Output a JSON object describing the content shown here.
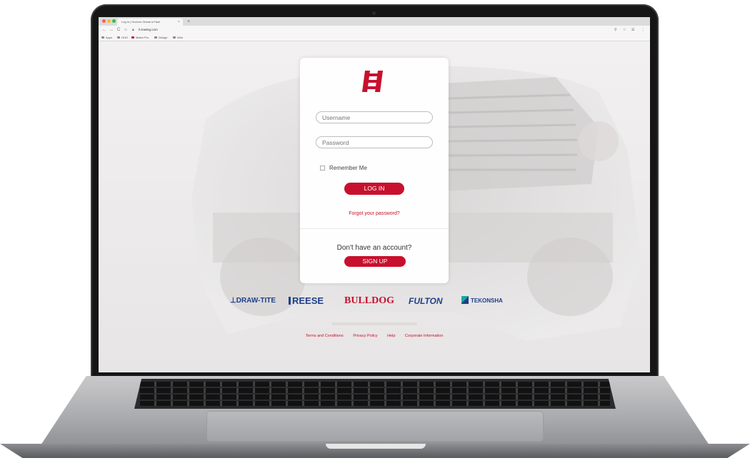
{
  "browser": {
    "tab_title": "Log In | Horizon Global a Pack",
    "tab_close": "×",
    "new_tab": "+",
    "address": "h-towing.com",
    "bookmarks": [
      "Apps",
      "HOG",
      "Match Pro",
      "Design",
      "Wire"
    ],
    "nav": {
      "back": "←",
      "forward": "→",
      "reload": "C",
      "home": "⌂"
    },
    "toolbar_right": [
      "⚲",
      "☆",
      "☰",
      "⋮"
    ]
  },
  "login": {
    "username_placeholder": "Username",
    "password_placeholder": "Password",
    "remember_label": "Remember Me",
    "login_label": "LOG IN",
    "forgot_label": "Forgot your password?",
    "no_account": "Don't have an account?",
    "signup_label": "SIGN UP"
  },
  "brands": [
    {
      "name": "DRAW-TITE",
      "color": "#1f3f8a"
    },
    {
      "name": "REESE",
      "color": "#1f3f8a"
    },
    {
      "name": "BULLDOG",
      "color": "#c8102e"
    },
    {
      "name": "FULTON",
      "color": "#1f3f8a"
    },
    {
      "name": "TEKONSHA",
      "color": "#1f3f8a"
    }
  ],
  "footer": {
    "links": [
      "Terms and Conditions",
      "Privacy Policy",
      "Help",
      "Corporate Information"
    ]
  },
  "colors": {
    "accent": "#c8102e",
    "brand_blue": "#1f3f8a",
    "brand_teal": "#1aa89a"
  }
}
